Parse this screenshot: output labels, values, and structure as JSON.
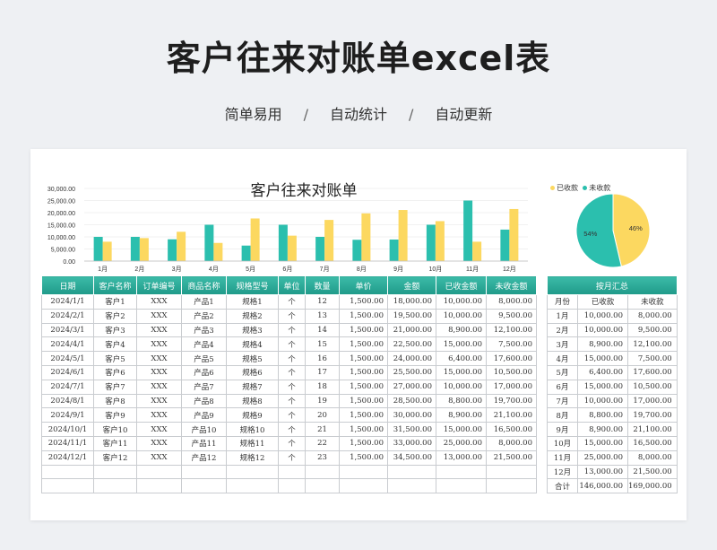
{
  "page": {
    "title": "客户往来对账单excel表",
    "tags": [
      "简单易用",
      "自动统计",
      "自动更新"
    ],
    "separator": "/"
  },
  "chart_data": [
    {
      "type": "bar",
      "title": "客户往来对账单",
      "categories": [
        "1月",
        "2月",
        "3月",
        "4月",
        "5月",
        "6月",
        "7月",
        "8月",
        "9月",
        "10月",
        "11月",
        "12月"
      ],
      "series": [
        {
          "values": [
            10000,
            10000,
            9000,
            15000,
            6400,
            15000,
            10000,
            8800,
            8900,
            15000,
            25000,
            13000
          ]
        },
        {
          "values": [
            8000,
            9500,
            12100,
            7500,
            17600,
            10500,
            17000,
            19700,
            21100,
            16500,
            8000,
            21500
          ]
        }
      ],
      "ylim": [
        0,
        30000
      ],
      "yticks": [
        "30,000.00",
        "25,000.00",
        "20,000.00",
        "15,000.00",
        "10,000.00",
        "5,000.00",
        "0.00"
      ],
      "colors": [
        "#2bbfae",
        "#fcd860"
      ],
      "grid": true
    },
    {
      "type": "pie",
      "legend": [
        "已收款",
        "未收款"
      ],
      "values": [
        146000,
        169000
      ],
      "labels": [
        "46%",
        "54%"
      ],
      "colors": [
        "#fcd860",
        "#2bbfae"
      ]
    }
  ],
  "ledger": {
    "headers": [
      "日期",
      "客户名称",
      "订单编号",
      "商品名称",
      "规格型号",
      "单位",
      "数量",
      "单价",
      "金额",
      "已收金额",
      "未收金额"
    ],
    "rows": [
      [
        "2024/1/1",
        "客户1",
        "XXX",
        "产品1",
        "规格1",
        "个",
        "12",
        "1,500.00",
        "18,000.00",
        "10,000.00",
        "8,000.00"
      ],
      [
        "2024/2/1",
        "客户2",
        "XXX",
        "产品2",
        "规格2",
        "个",
        "13",
        "1,500.00",
        "19,500.00",
        "10,000.00",
        "9,500.00"
      ],
      [
        "2024/3/1",
        "客户3",
        "XXX",
        "产品3",
        "规格3",
        "个",
        "14",
        "1,500.00",
        "21,000.00",
        "8,900.00",
        "12,100.00"
      ],
      [
        "2024/4/1",
        "客户4",
        "XXX",
        "产品4",
        "规格4",
        "个",
        "15",
        "1,500.00",
        "22,500.00",
        "15,000.00",
        "7,500.00"
      ],
      [
        "2024/5/1",
        "客户5",
        "XXX",
        "产品5",
        "规格5",
        "个",
        "16",
        "1,500.00",
        "24,000.00",
        "6,400.00",
        "17,600.00"
      ],
      [
        "2024/6/1",
        "客户6",
        "XXX",
        "产品6",
        "规格6",
        "个",
        "17",
        "1,500.00",
        "25,500.00",
        "15,000.00",
        "10,500.00"
      ],
      [
        "2024/7/1",
        "客户7",
        "XXX",
        "产品7",
        "规格7",
        "个",
        "18",
        "1,500.00",
        "27,000.00",
        "10,000.00",
        "17,000.00"
      ],
      [
        "2024/8/1",
        "客户8",
        "XXX",
        "产品8",
        "规格8",
        "个",
        "19",
        "1,500.00",
        "28,500.00",
        "8,800.00",
        "19,700.00"
      ],
      [
        "2024/9/1",
        "客户9",
        "XXX",
        "产品9",
        "规格9",
        "个",
        "20",
        "1,500.00",
        "30,000.00",
        "8,900.00",
        "21,100.00"
      ],
      [
        "2024/10/1",
        "客户10",
        "XXX",
        "产品10",
        "规格10",
        "个",
        "21",
        "1,500.00",
        "31,500.00",
        "15,000.00",
        "16,500.00"
      ],
      [
        "2024/11/1",
        "客户11",
        "XXX",
        "产品11",
        "规格11",
        "个",
        "22",
        "1,500.00",
        "33,000.00",
        "25,000.00",
        "8,000.00"
      ],
      [
        "2024/12/1",
        "客户12",
        "XXX",
        "产品12",
        "规格12",
        "个",
        "23",
        "1,500.00",
        "34,500.00",
        "13,000.00",
        "21,500.00"
      ],
      [
        "",
        "",
        "",
        "",
        "",
        "",
        "",
        "",
        "",
        "",
        ""
      ],
      [
        "",
        "",
        "",
        "",
        "",
        "",
        "",
        "",
        "",
        "",
        ""
      ]
    ]
  },
  "summary": {
    "title": "按月汇总",
    "headers": [
      "月份",
      "已收款",
      "未收款"
    ],
    "rows": [
      [
        "1月",
        "10,000.00",
        "8,000.00"
      ],
      [
        "2月",
        "10,000.00",
        "9,500.00"
      ],
      [
        "3月",
        "8,900.00",
        "12,100.00"
      ],
      [
        "4月",
        "15,000.00",
        "7,500.00"
      ],
      [
        "5月",
        "6,400.00",
        "17,600.00"
      ],
      [
        "6月",
        "15,000.00",
        "10,500.00"
      ],
      [
        "7月",
        "10,000.00",
        "17,000.00"
      ],
      [
        "8月",
        "8,800.00",
        "19,700.00"
      ],
      [
        "9月",
        "8,900.00",
        "21,100.00"
      ],
      [
        "10月",
        "15,000.00",
        "16,500.00"
      ],
      [
        "11月",
        "25,000.00",
        "8,000.00"
      ],
      [
        "12月",
        "13,000.00",
        "21,500.00"
      ],
      [
        "合计",
        "146,000.00",
        "169,000.00"
      ]
    ]
  }
}
